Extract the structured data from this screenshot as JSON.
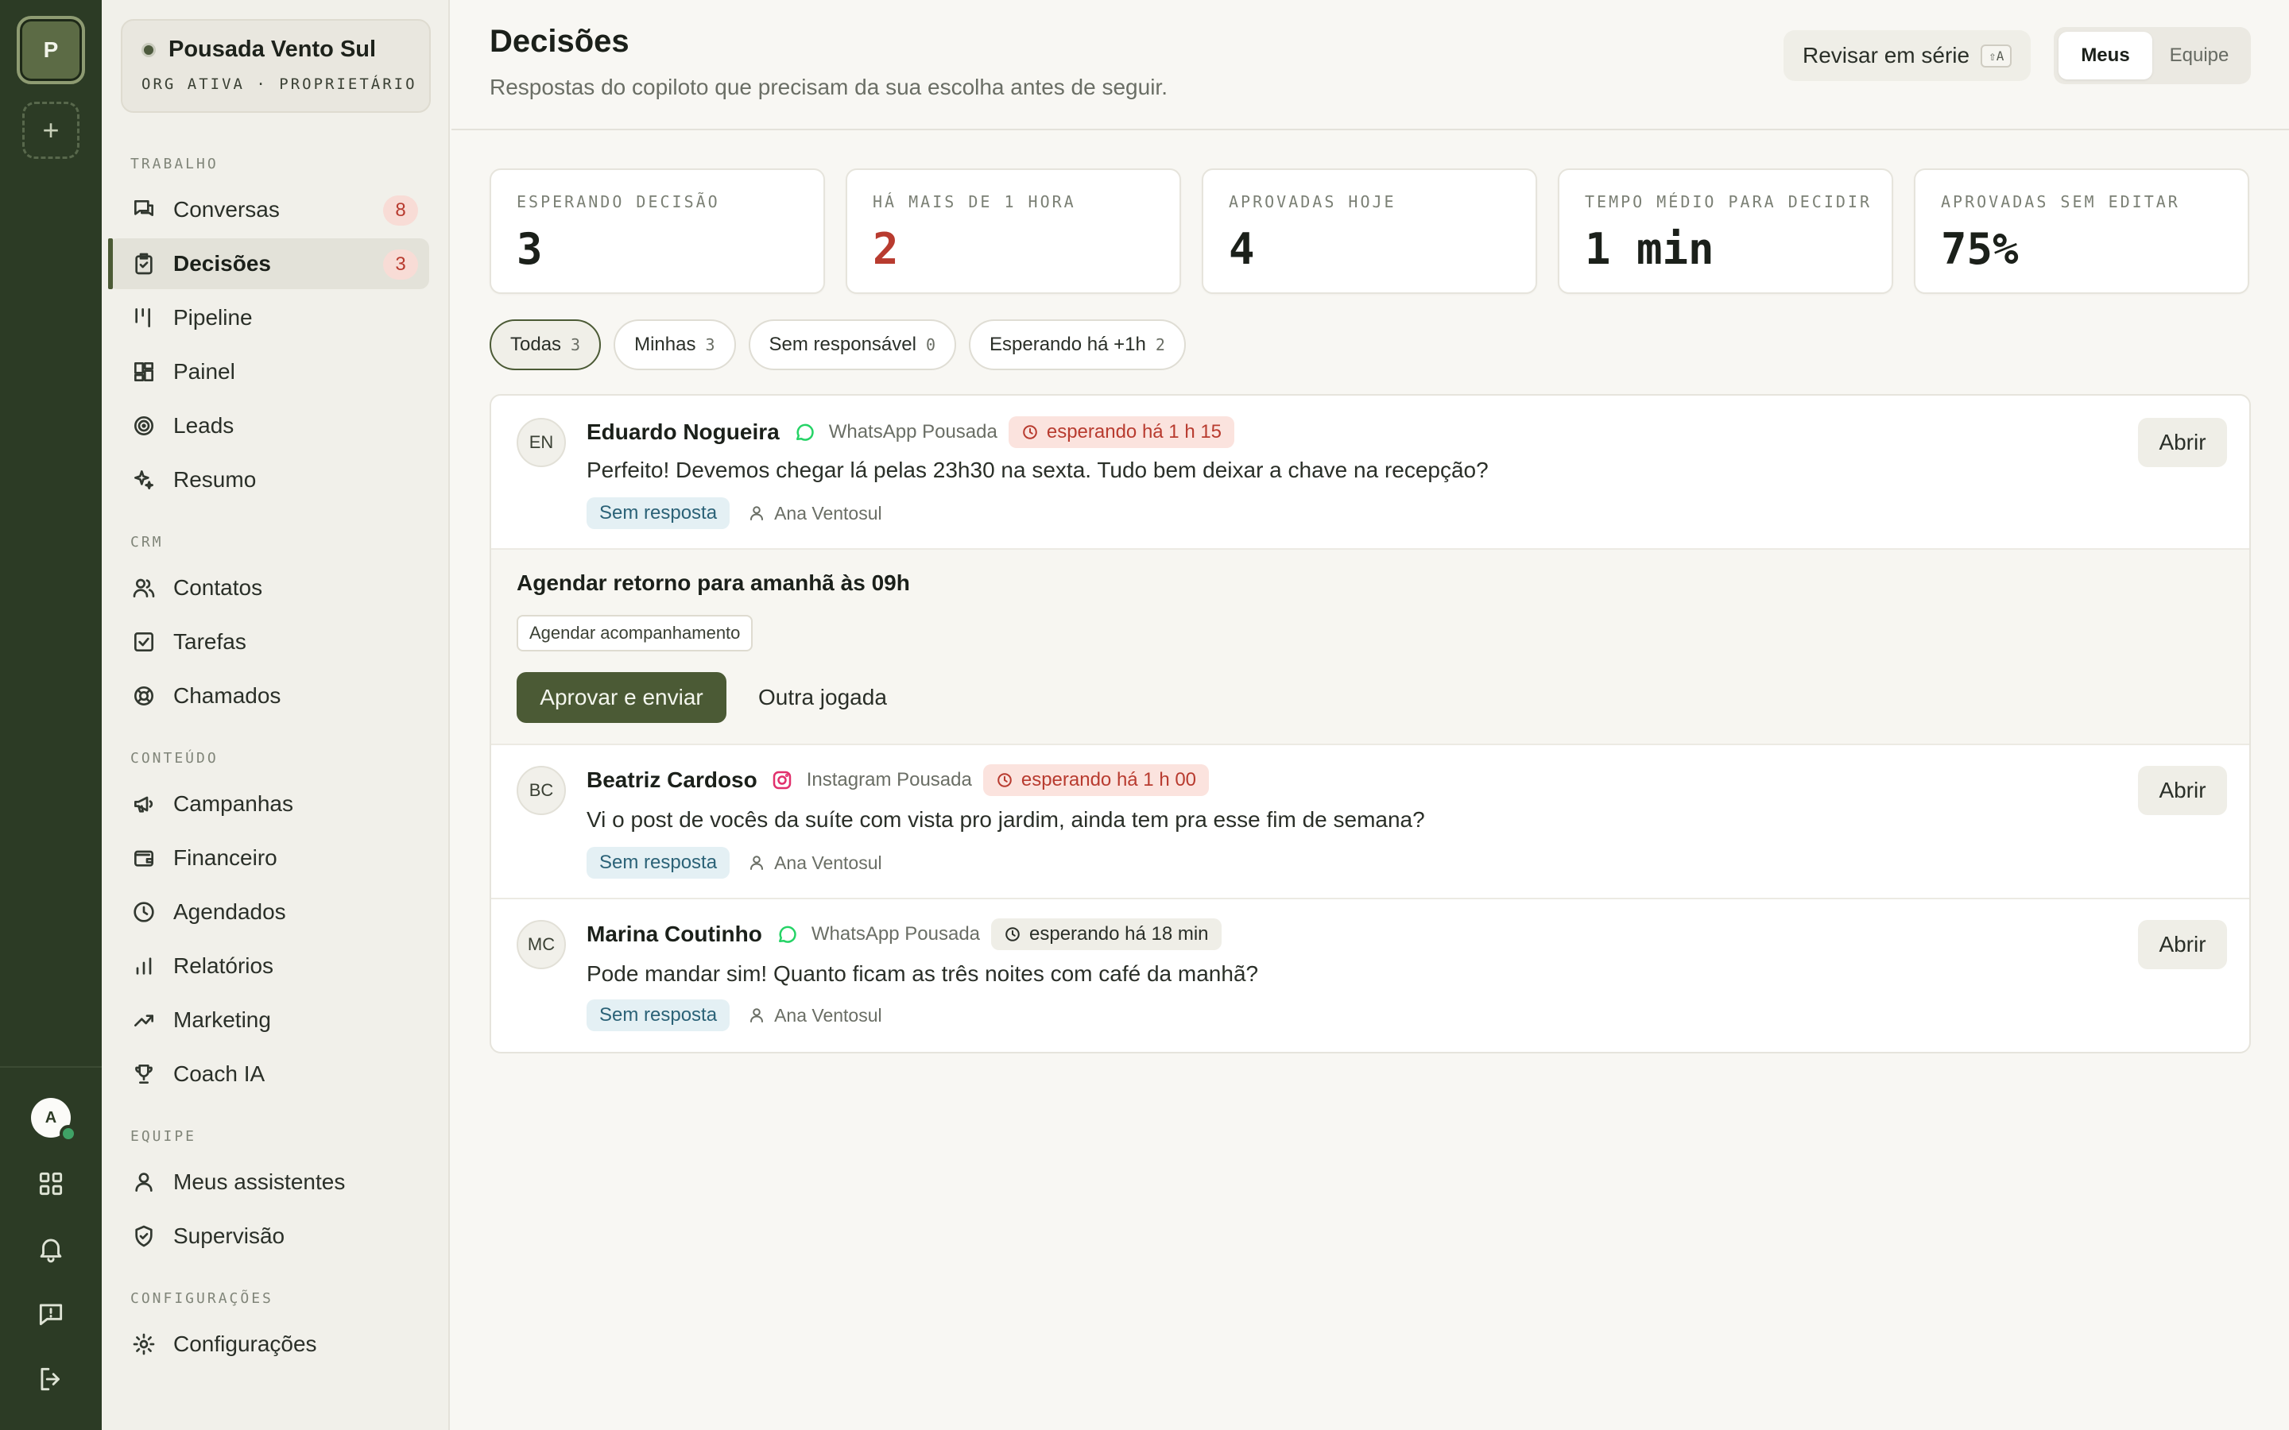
{
  "rail": {
    "org_initial": "P",
    "add_symbol": "+",
    "user_initial": "A",
    "icons": [
      "apps-grid-icon",
      "bell-icon",
      "feedback-icon",
      "logout-icon"
    ]
  },
  "org": {
    "name": "Pousada Vento Sul",
    "role": "ORG ATIVA · PROPRIETÁRIO"
  },
  "sidebar": {
    "sections": {
      "trabalho": "TRABALHO",
      "crm": "CRM",
      "conteudo": "CONTEÚDO",
      "equipe": "EQUIPE",
      "config": "CONFIGURAÇÕES"
    },
    "items": {
      "conversas": {
        "label": "Conversas",
        "badge": "8",
        "icon": "chat-icon"
      },
      "decisoes": {
        "label": "Decisões",
        "badge": "3",
        "icon": "clipboard-icon"
      },
      "pipeline": {
        "label": "Pipeline",
        "icon": "pipeline-icon"
      },
      "painel": {
        "label": "Painel",
        "icon": "dashboard-icon"
      },
      "leads": {
        "label": "Leads",
        "icon": "target-icon"
      },
      "resumo": {
        "label": "Resumo",
        "icon": "sparkles-icon"
      },
      "contatos": {
        "label": "Contatos",
        "icon": "users-icon"
      },
      "tarefas": {
        "label": "Tarefas",
        "icon": "checkbox-icon"
      },
      "chamados": {
        "label": "Chamados",
        "icon": "lifebuoy-icon"
      },
      "campanhas": {
        "label": "Campanhas",
        "icon": "megaphone-icon"
      },
      "financeiro": {
        "label": "Financeiro",
        "icon": "wallet-icon"
      },
      "agendados": {
        "label": "Agendados",
        "icon": "clock-icon"
      },
      "relatorios": {
        "label": "Relatórios",
        "icon": "bar-chart-icon"
      },
      "marketing": {
        "label": "Marketing",
        "icon": "trend-icon"
      },
      "coach": {
        "label": "Coach IA",
        "icon": "trophy-icon"
      },
      "assistentes": {
        "label": "Meus assistentes",
        "icon": "user-icon"
      },
      "supervisao": {
        "label": "Supervisão",
        "icon": "shield-icon"
      },
      "configuracoes": {
        "label": "Configurações",
        "icon": "gear-icon"
      }
    }
  },
  "header": {
    "title": "Decisões",
    "subtitle": "Respostas do copiloto que precisam da sua escolha antes de seguir.",
    "batch_label": "Revisar em série",
    "batch_shortcut": "⇧A",
    "toggle": {
      "mine": "Meus",
      "team": "Equipe",
      "selected": "Meus"
    }
  },
  "stats": [
    {
      "label": "ESPERANDO DECISÃO",
      "value": "3"
    },
    {
      "label": "HÁ MAIS DE 1 HORA",
      "value": "2"
    },
    {
      "label": "APROVADAS HOJE",
      "value": "4"
    },
    {
      "label": "TEMPO MÉDIO PARA DECIDIR",
      "value": "1 min"
    },
    {
      "label": "APROVADAS SEM EDITAR",
      "value": "75%"
    }
  ],
  "filters": [
    {
      "label": "Todas",
      "count": "3"
    },
    {
      "label": "Minhas",
      "count": "3"
    },
    {
      "label": "Sem responsável",
      "count": "0"
    },
    {
      "label": "Esperando há +1h",
      "count": "2"
    }
  ],
  "decisions": [
    {
      "initials": "EN",
      "name": "Eduardo Nogueira",
      "channel": "WhatsApp Pousada",
      "wait": "esperando há 1 h 15",
      "message": "Perfeito! Devemos chegar lá pelas 23h30 na sexta. Tudo bem deixar a chave na recepção?",
      "status": "Sem resposta",
      "assignee": "Ana Ventosul",
      "open_label": "Abrir"
    },
    {
      "initials": "BC",
      "name": "Beatriz Cardoso",
      "channel": "Instagram Pousada",
      "wait": "esperando há 1 h 00",
      "message": "Vi o post de vocês da suíte com vista pro jardim, ainda tem pra esse fim de semana?",
      "status": "Sem resposta",
      "assignee": "Ana Ventosul",
      "open_label": "Abrir"
    },
    {
      "initials": "MC",
      "name": "Marina Coutinho",
      "channel": "WhatsApp Pousada",
      "wait": "esperando há 18 min",
      "message": "Pode mandar sim! Quanto ficam as três noites com café da manhã?",
      "status": "Sem resposta",
      "assignee": "Ana Ventosul",
      "open_label": "Abrir"
    }
  ],
  "suggestion": {
    "title": "Agendar retorno para amanhã às 09h",
    "tag": "Agendar acompanhamento",
    "approve": "Aprovar e enviar",
    "alternative": "Outra jogada"
  },
  "colors": {
    "rail": "#2c3b25",
    "accent": "#4b5a35",
    "alert": "#b83b2f",
    "status_pill": "#e4f0f4",
    "whatsapp": "#25d366",
    "instagram": "#e1306c"
  }
}
